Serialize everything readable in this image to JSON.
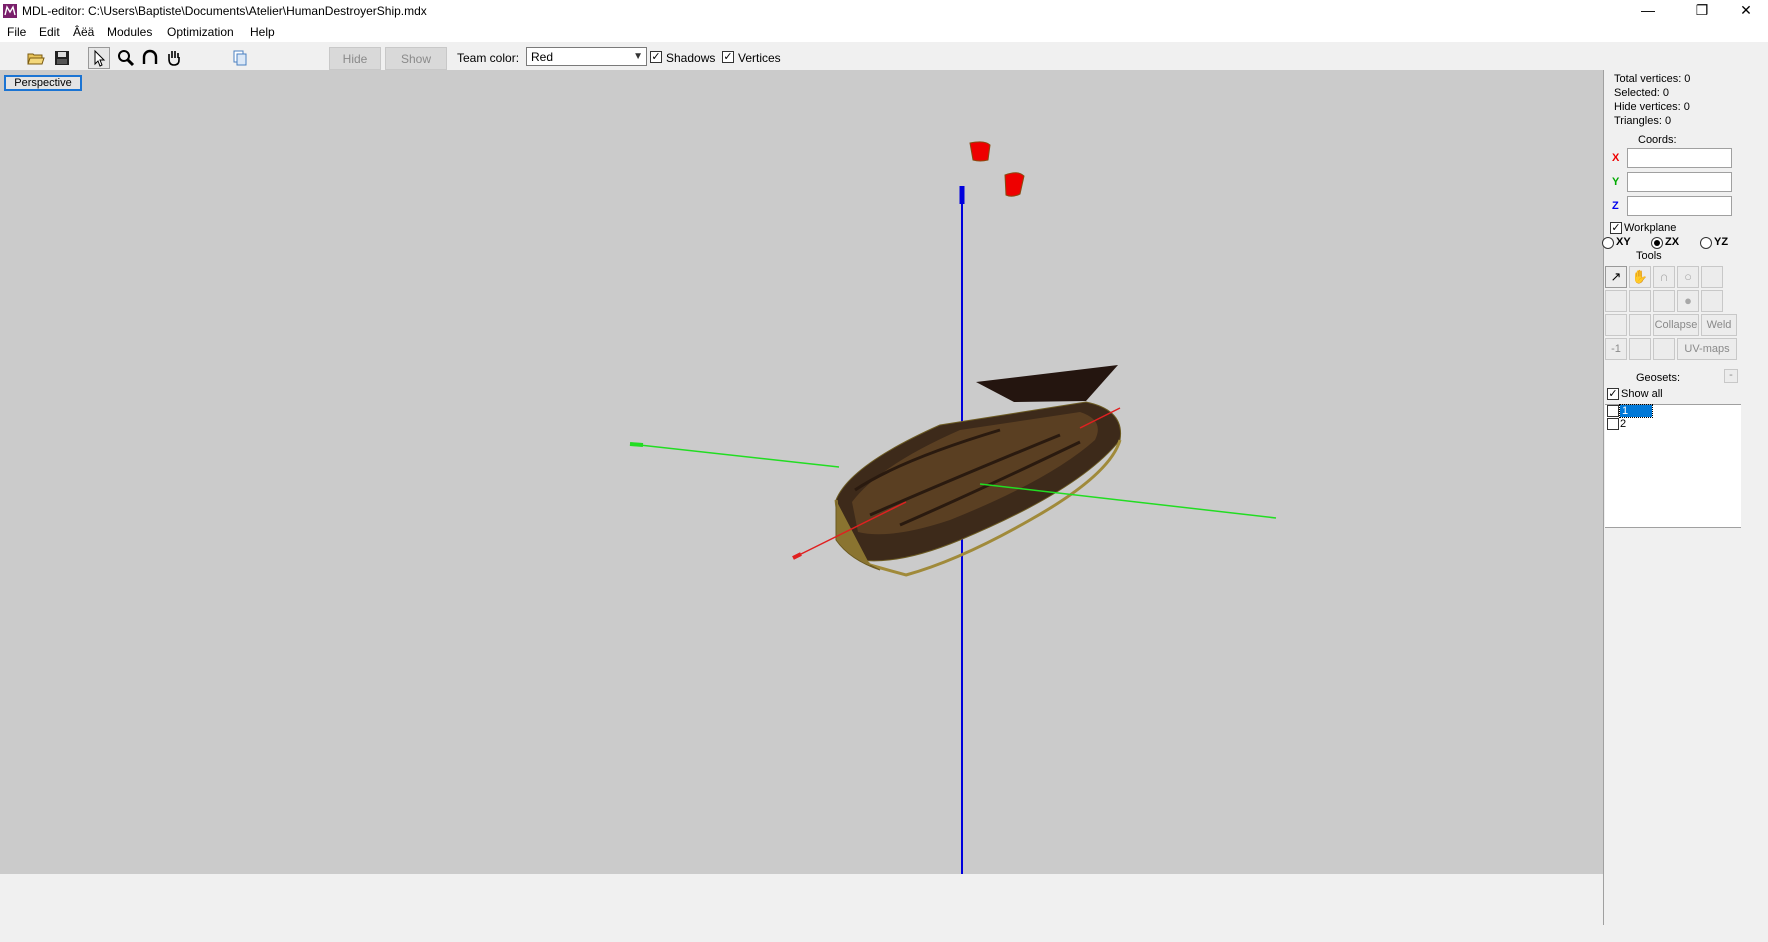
{
  "window": {
    "title": "MDL-editor: C:\\Users\\Baptiste\\Documents\\Atelier\\HumanDestroyerShip.mdx",
    "minimize": "—",
    "restore": "❐",
    "close": "✕"
  },
  "menu": [
    "File",
    "Edit",
    "Âëä",
    "Modules",
    "Optimization",
    "Help"
  ],
  "toolbar": {
    "icons": [
      "open-folder-icon",
      "save-icon",
      "select-cursor-icon",
      "zoom-icon",
      "rotate-icon",
      "pan-hand-icon",
      "copy-icon"
    ],
    "hide_label": "Hide",
    "show_label": "Show",
    "team_color_label": "Team color:",
    "team_color_value": "Red",
    "shadows_label": "Shadows",
    "shadows_checked": true,
    "vertices_label": "Vertices",
    "vertices_checked": true
  },
  "viewport": {
    "mode_label": "Perspective",
    "background": "#cbcbcb",
    "axis_colors": {
      "x": "#e02020",
      "y": "#22dd22",
      "z": "#0000dd"
    }
  },
  "panel": {
    "stats": {
      "total_vertices": "Total vertices: 0",
      "selected": "Selected: 0",
      "hide_vertices": "Hide vertices: 0",
      "triangles": "Triangles: 0"
    },
    "coords_title": "Coords:",
    "x_label": "X",
    "y_label": "Y",
    "z_label": "Z",
    "x_value": "",
    "y_value": "",
    "z_value": "",
    "workplane_label": "Workplane",
    "workplane_checked": true,
    "planes": [
      "XY",
      "ZX",
      "YZ"
    ],
    "selected_plane": "ZX",
    "tools_title": "Tools",
    "collapse_label": "Collapse",
    "weld_label": "Weld",
    "minus_one_label": "-1",
    "uvmaps_label": "UV-maps",
    "geosets_title": "Geosets:",
    "geosets_toggle": "-",
    "show_all_label": "Show all",
    "show_all_checked": true,
    "geosets": [
      "1",
      "2"
    ],
    "selected_geoset": "1"
  }
}
